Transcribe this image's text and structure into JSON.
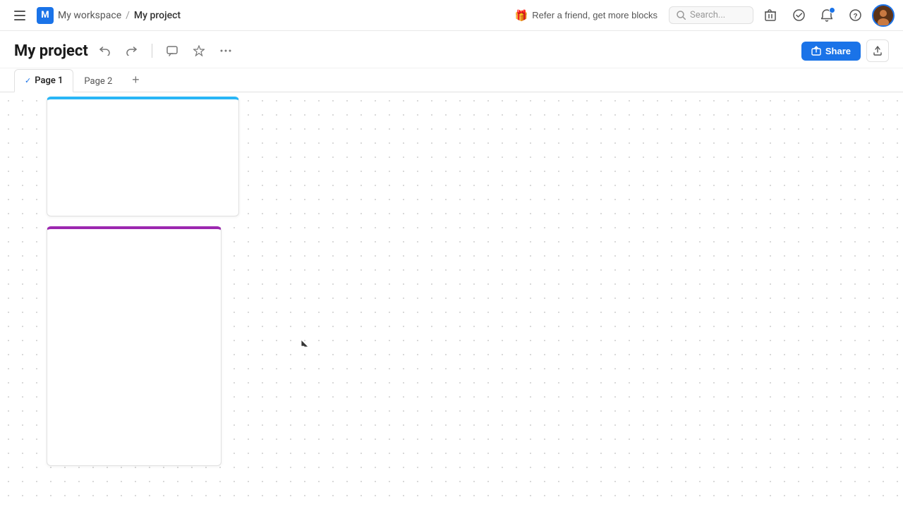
{
  "nav": {
    "hamburger_label": "☰",
    "workspace_initial": "M",
    "workspace_name": "My workspace",
    "breadcrumb_sep": "/",
    "project_name": "My project",
    "refer_label": "Refer a friend, get more blocks",
    "search_placeholder": "Search...",
    "icons": {
      "trash": "🗑",
      "check_circle": "✓",
      "bell": "🔔",
      "help": "?",
      "search": "🔍"
    }
  },
  "header": {
    "title": "My project",
    "undo_label": "↩",
    "redo_label": "↪",
    "comment_label": "💬",
    "star_label": "☆",
    "more_label": "···",
    "share_label": "Share",
    "export_label": "↑"
  },
  "tabs": [
    {
      "id": "page1",
      "label": "Page 1",
      "active": true
    },
    {
      "id": "page2",
      "label": "Page 2",
      "active": false
    }
  ],
  "canvas": {
    "add_tab_label": "+",
    "card_blue_top_color": "#29b6f6",
    "card_purple_top_color": "#9c27b0"
  }
}
